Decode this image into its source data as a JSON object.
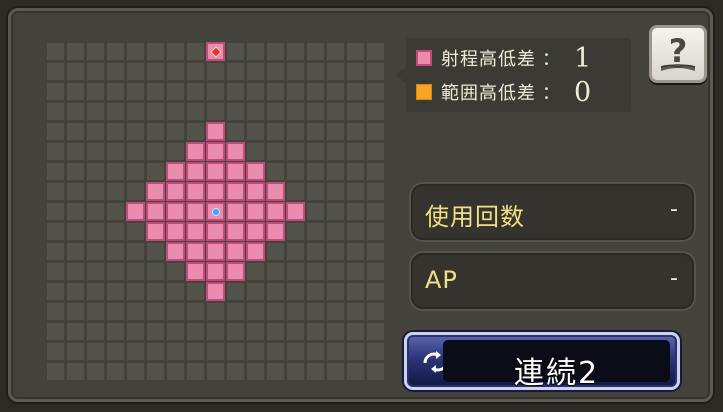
{
  "range_info": {
    "range_height_label": "射程高低差",
    "range_height_colon": "：",
    "range_height_value": "1",
    "area_height_label": "範囲高低差",
    "area_height_colon": "：",
    "area_height_value": "0"
  },
  "help": {
    "icon": "question-book-icon"
  },
  "uses": {
    "label": "使用回数",
    "value": "-"
  },
  "ap": {
    "label": "AP",
    "value": "-"
  },
  "combo_button": {
    "label": "連続2",
    "icon": "rotate-arrows-icon"
  },
  "range_grid": {
    "columns": 17,
    "rows": 17,
    "center_cell": [
      8,
      8
    ],
    "target_marker_cell": [
      8,
      0
    ],
    "range_radius": 4,
    "target_cells_excluded_from_range": [
      [
        8,
        0
      ]
    ],
    "colors": {
      "empty_cell": "#54534b",
      "range_fill": "#e98cae",
      "range_border": "#c04a7a",
      "area_swatch": "#f7a425",
      "center_dot": "#3fa4ff",
      "target_marker": "#e8322a"
    }
  }
}
